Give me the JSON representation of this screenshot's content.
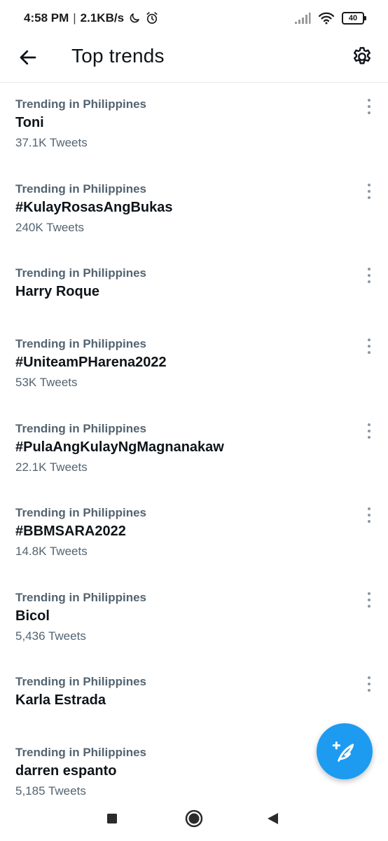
{
  "status_bar": {
    "time": "4:58 PM",
    "separator": "|",
    "speed": "2.1KB/s",
    "battery": "40",
    "icons": [
      "moon-icon",
      "alarm-icon",
      "signal-icon",
      "wifi-icon",
      "battery-icon"
    ]
  },
  "header": {
    "title": "Top trends",
    "back_icon": "arrow-left-icon",
    "settings_icon": "gear-icon"
  },
  "trends": [
    {
      "context": "Trending in Philippines",
      "name": "Toni",
      "count": "37.1K Tweets"
    },
    {
      "context": "Trending in Philippines",
      "name": "#KulayRosasAngBukas",
      "count": "240K Tweets"
    },
    {
      "context": "Trending in Philippines",
      "name": "Harry Roque",
      "count": ""
    },
    {
      "context": "Trending in Philippines",
      "name": "#UniteamPHarena2022",
      "count": "53K Tweets"
    },
    {
      "context": "Trending in Philippines",
      "name": "#PulaAngKulayNgMagnanakaw",
      "count": "22.1K Tweets"
    },
    {
      "context": "Trending in Philippines",
      "name": "#BBMSARA2022",
      "count": "14.8K Tweets"
    },
    {
      "context": "Trending in Philippines",
      "name": "Bicol",
      "count": "5,436 Tweets"
    },
    {
      "context": "Trending in Philippines",
      "name": "Karla Estrada",
      "count": ""
    },
    {
      "context": "Trending in Philippines",
      "name": "darren espanto",
      "count": "5,185 Tweets"
    }
  ],
  "fab": {
    "icon": "compose-feather-icon"
  },
  "nav_bar": {
    "icons": [
      "square-recents-icon",
      "circle-home-icon",
      "triangle-back-icon"
    ]
  },
  "colors": {
    "accent": "#1d9bf0",
    "primary_text": "#0f1419",
    "secondary_text": "#536471",
    "divider": "#e7e9ea"
  }
}
